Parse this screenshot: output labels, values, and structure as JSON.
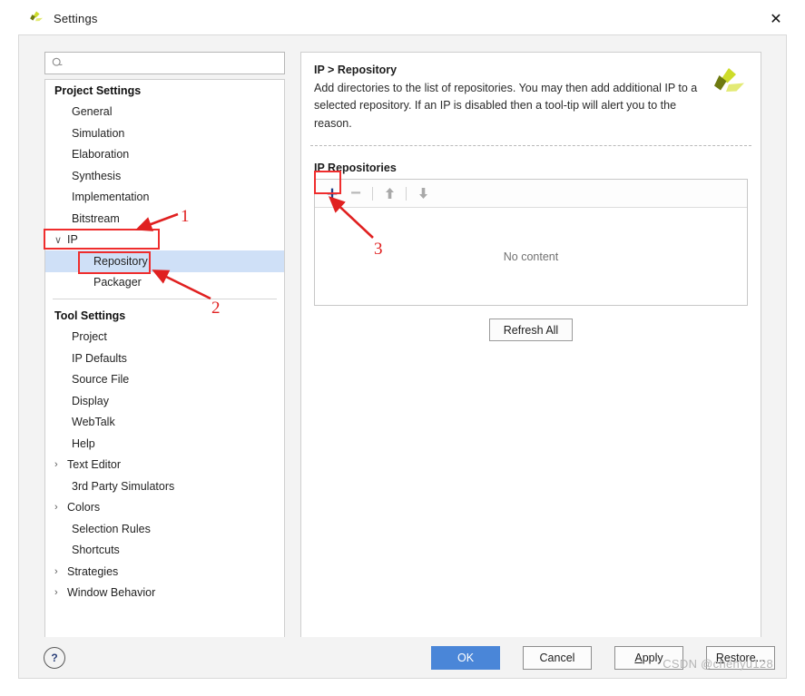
{
  "window": {
    "title": "Settings",
    "icon": "vivado-logo-icon",
    "close_label": "✕"
  },
  "search": {
    "placeholder": "",
    "value": "",
    "icon": "search-icon",
    "hint": "Q-"
  },
  "sidebar": {
    "groups": [
      {
        "label": "Project Settings",
        "items": [
          {
            "label": "General",
            "level": 1,
            "expandable": false
          },
          {
            "label": "Simulation",
            "level": 1,
            "expandable": false
          },
          {
            "label": "Elaboration",
            "level": 1,
            "expandable": false
          },
          {
            "label": "Synthesis",
            "level": 1,
            "expandable": false
          },
          {
            "label": "Implementation",
            "level": 1,
            "expandable": false
          },
          {
            "label": "Bitstream",
            "level": 1,
            "expandable": false
          },
          {
            "label": "IP",
            "level": 1,
            "expandable": true,
            "expanded": true,
            "twisty": "∨"
          },
          {
            "label": "Repository",
            "level": 2,
            "expandable": false,
            "selected": true
          },
          {
            "label": "Packager",
            "level": 2,
            "expandable": false
          }
        ]
      },
      {
        "label": "Tool Settings",
        "items": [
          {
            "label": "Project",
            "level": 1,
            "expandable": false
          },
          {
            "label": "IP Defaults",
            "level": 1,
            "expandable": false
          },
          {
            "label": "Source File",
            "level": 1,
            "expandable": false
          },
          {
            "label": "Display",
            "level": 1,
            "expandable": false
          },
          {
            "label": "WebTalk",
            "level": 1,
            "expandable": false
          },
          {
            "label": "Help",
            "level": 1,
            "expandable": false
          },
          {
            "label": "Text Editor",
            "level": 1,
            "expandable": true,
            "expanded": false,
            "twisty": "›"
          },
          {
            "label": "3rd Party Simulators",
            "level": 1,
            "expandable": false
          },
          {
            "label": "Colors",
            "level": 1,
            "expandable": true,
            "expanded": false,
            "twisty": "›"
          },
          {
            "label": "Selection Rules",
            "level": 1,
            "expandable": false
          },
          {
            "label": "Shortcuts",
            "level": 1,
            "expandable": false
          },
          {
            "label": "Strategies",
            "level": 1,
            "expandable": true,
            "expanded": false,
            "twisty": "›"
          },
          {
            "label": "Window Behavior",
            "level": 1,
            "expandable": true,
            "expanded": false,
            "twisty": "›"
          }
        ]
      }
    ]
  },
  "panel": {
    "breadcrumb": "IP > Repository",
    "description": "Add directories to the list of repositories. You may then add additional IP to a selected repository. If an IP is disabled then a tool-tip will alert you to the reason.",
    "logo": "vivado-logo-icon",
    "section_label": "IP Repositories",
    "toolbar": {
      "add_label": "+",
      "remove_label": "−",
      "move_up_icon": "arrow-up-icon",
      "move_down_icon": "arrow-down-icon"
    },
    "list_empty_text": "No content",
    "refresh_label": "Refresh All"
  },
  "footer": {
    "help_label": "?",
    "buttons": [
      {
        "label": "OK",
        "primary": true,
        "mnemonic": ""
      },
      {
        "label": "Cancel",
        "primary": false,
        "mnemonic": ""
      },
      {
        "label": "Apply",
        "primary": false,
        "mnemonic": "A"
      },
      {
        "label": "Restore...",
        "primary": false,
        "mnemonic": "R"
      }
    ]
  },
  "annotations": {
    "color": "#e02020",
    "markers": [
      {
        "number": "1",
        "target": "sidebar-item-ip"
      },
      {
        "number": "2",
        "target": "sidebar-item-repository"
      },
      {
        "number": "3",
        "target": "add-repository-button"
      }
    ]
  },
  "watermark": {
    "text": "CSDN @chenyu128"
  }
}
